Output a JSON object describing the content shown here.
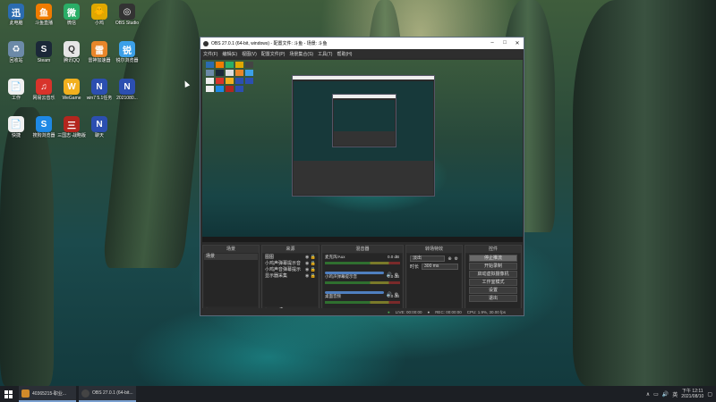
{
  "desktop_icons": [
    {
      "label": "此电脑",
      "icon": "computer-icon",
      "color": "#2b6cb0",
      "glyph": "迅"
    },
    {
      "label": "斗鱼直播",
      "icon": "douyu-icon",
      "color": "#f07c00",
      "glyph": "鱼"
    },
    {
      "label": "微信",
      "icon": "wechat-icon",
      "color": "#2aae67",
      "glyph": "微"
    },
    {
      "label": "小鸡",
      "icon": "game-icon",
      "color": "#e0a800",
      "glyph": "🐥"
    },
    {
      "label": "OBS Studio",
      "icon": "obs-icon",
      "color": "#333333",
      "glyph": "◎"
    },
    {
      "label": "回收站",
      "icon": "recycle-bin-icon",
      "color": "#6c8aa8",
      "glyph": "♻"
    },
    {
      "label": "Steam",
      "icon": "steam-icon",
      "color": "#1b2838",
      "glyph": "S"
    },
    {
      "label": "腾讯QQ",
      "icon": "qq-icon",
      "color": "#e6e6e6",
      "glyph": "Q"
    },
    {
      "label": "雷神加速器",
      "icon": "accelerator-icon",
      "color": "#e8862a",
      "glyph": "雷"
    },
    {
      "label": "锐尔浏览器",
      "icon": "browser-icon",
      "color": "#3ca0e8",
      "glyph": "锐"
    },
    {
      "label": "工作",
      "icon": "document-icon",
      "color": "#f0f0f0",
      "glyph": "📄"
    },
    {
      "label": "网易云音乐",
      "icon": "netease-music-icon",
      "color": "#d8332b",
      "glyph": "♫"
    },
    {
      "label": "WeGame",
      "icon": "wegame-icon",
      "color": "#f2b01e",
      "glyph": "W"
    },
    {
      "label": "win7 5.1任务",
      "icon": "window-icon",
      "color": "#2c4fb0",
      "glyph": "N"
    },
    {
      "label": "2021080...",
      "icon": "file-icon",
      "color": "#2c4fb0",
      "glyph": "N"
    },
    {
      "label": "快捷",
      "icon": "shortcut-icon",
      "color": "#f0f0f0",
      "glyph": "📄"
    },
    {
      "label": "搜狗浏览器",
      "icon": "sogou-icon",
      "color": "#1e88e5",
      "glyph": "S"
    },
    {
      "label": "三国志·战略版",
      "icon": "sanguo-icon",
      "color": "#b3261e",
      "glyph": "三"
    },
    {
      "label": "聊天",
      "icon": "chat-icon",
      "color": "#2c4fb0",
      "glyph": "N"
    }
  ],
  "obs": {
    "title": "OBS 27.0.1 (64-bit, windows) - 配置文件: 斗鱼 - 场景: 斗鱼",
    "menu": [
      "文件(F)",
      "编辑(E)",
      "视图(V)",
      "配置文件(P)",
      "场景集合(S)",
      "工具(T)",
      "帮助(H)"
    ],
    "docks": {
      "scenes": {
        "title": "场景",
        "items": [
          "场景"
        ]
      },
      "sources": {
        "title": "来源",
        "items": [
          "图图",
          "小鸡声弹幕提示音",
          "小鸡声音弹幕提示",
          "显示器采集"
        ]
      },
      "mixer": {
        "title": "混音器",
        "channels": [
          {
            "name": "麦克风/Aux",
            "db": "0.0 dB"
          },
          {
            "name": "小鸡声弹幕提示音",
            "db": "0.0 dB"
          },
          {
            "name": "桌面音频",
            "db": "0.0 dB"
          }
        ]
      },
      "transitions": {
        "title": "转场特效",
        "type": "淡出",
        "duration_label": "时长",
        "duration": "300 ms"
      },
      "controls": {
        "title": "控件",
        "buttons": [
          "停止推流",
          "开始录制",
          "启动虚拟摄像机",
          "工作室模式",
          "设置",
          "退出"
        ]
      }
    },
    "status": {
      "live": "LIVE: 00:00:00",
      "rec": "REC: 00:00:00",
      "cpu": "CPU: 1.9%, 30.00 fps"
    }
  },
  "taskbar": {
    "items": [
      {
        "label": "40365215-职业...",
        "icon": "video-file-icon",
        "color": "#d08a2a"
      },
      {
        "label": "OBS 27.0.1 (64-bit...",
        "icon": "obs-icon",
        "color": "#444444"
      }
    ],
    "tray_lang": "英",
    "clock_time": "下午 12:11",
    "clock_date": "2021/08/10"
  },
  "colors": {
    "accent": "#7aa0d0",
    "obs_bg": "#2b2b2b"
  }
}
